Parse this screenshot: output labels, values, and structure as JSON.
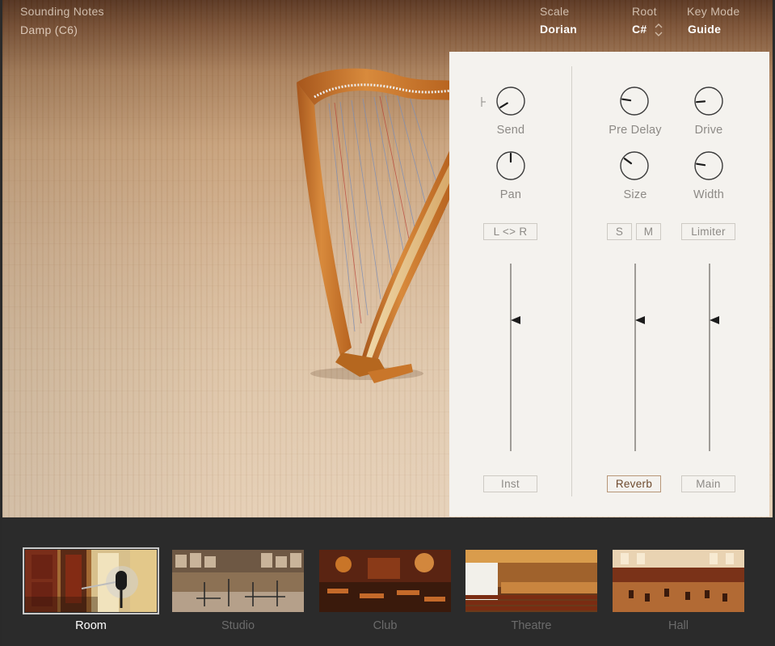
{
  "header": {
    "preset_title": "Sounding Notes",
    "preset_sub": "Damp (C6)",
    "scale_label": "Scale",
    "scale_value": "Dorian",
    "root_label": "Root",
    "root_value": "C#",
    "keymode_label": "Key Mode",
    "keymode_value": "Guide"
  },
  "mixer": {
    "inst": {
      "send_label": "Send",
      "pan_label": "Pan",
      "lr_button": "L <> R",
      "channel_label": "Inst",
      "send_level": 0.05,
      "pan_level": 0.5,
      "fader_level": 0.7
    },
    "reverb": {
      "predelay_label": "Pre Delay",
      "size_label": "Size",
      "solo_button": "S",
      "mute_button": "M",
      "channel_label": "Reverb",
      "channel_active": true,
      "predelay_level": 0.2,
      "size_level": 0.3,
      "fader_level": 0.7
    },
    "main": {
      "drive_label": "Drive",
      "width_label": "Width",
      "limiter_button": "Limiter",
      "channel_label": "Main",
      "drive_level": 0.15,
      "width_level": 0.2,
      "fader_level": 0.7
    }
  },
  "rooms": {
    "items": [
      {
        "label": "Room",
        "selected": true
      },
      {
        "label": "Studio",
        "selected": false
      },
      {
        "label": "Club",
        "selected": false
      },
      {
        "label": "Theatre",
        "selected": false
      },
      {
        "label": "Hall",
        "selected": false
      }
    ]
  },
  "icons": [
    "harp-icon",
    "stepper-arrows-icon",
    "microphone-icon"
  ],
  "colors": {
    "panel": "#f4f2ee",
    "strip": "#2b2b2b",
    "accent": "#b79677",
    "selected_label": "#ffffff"
  }
}
